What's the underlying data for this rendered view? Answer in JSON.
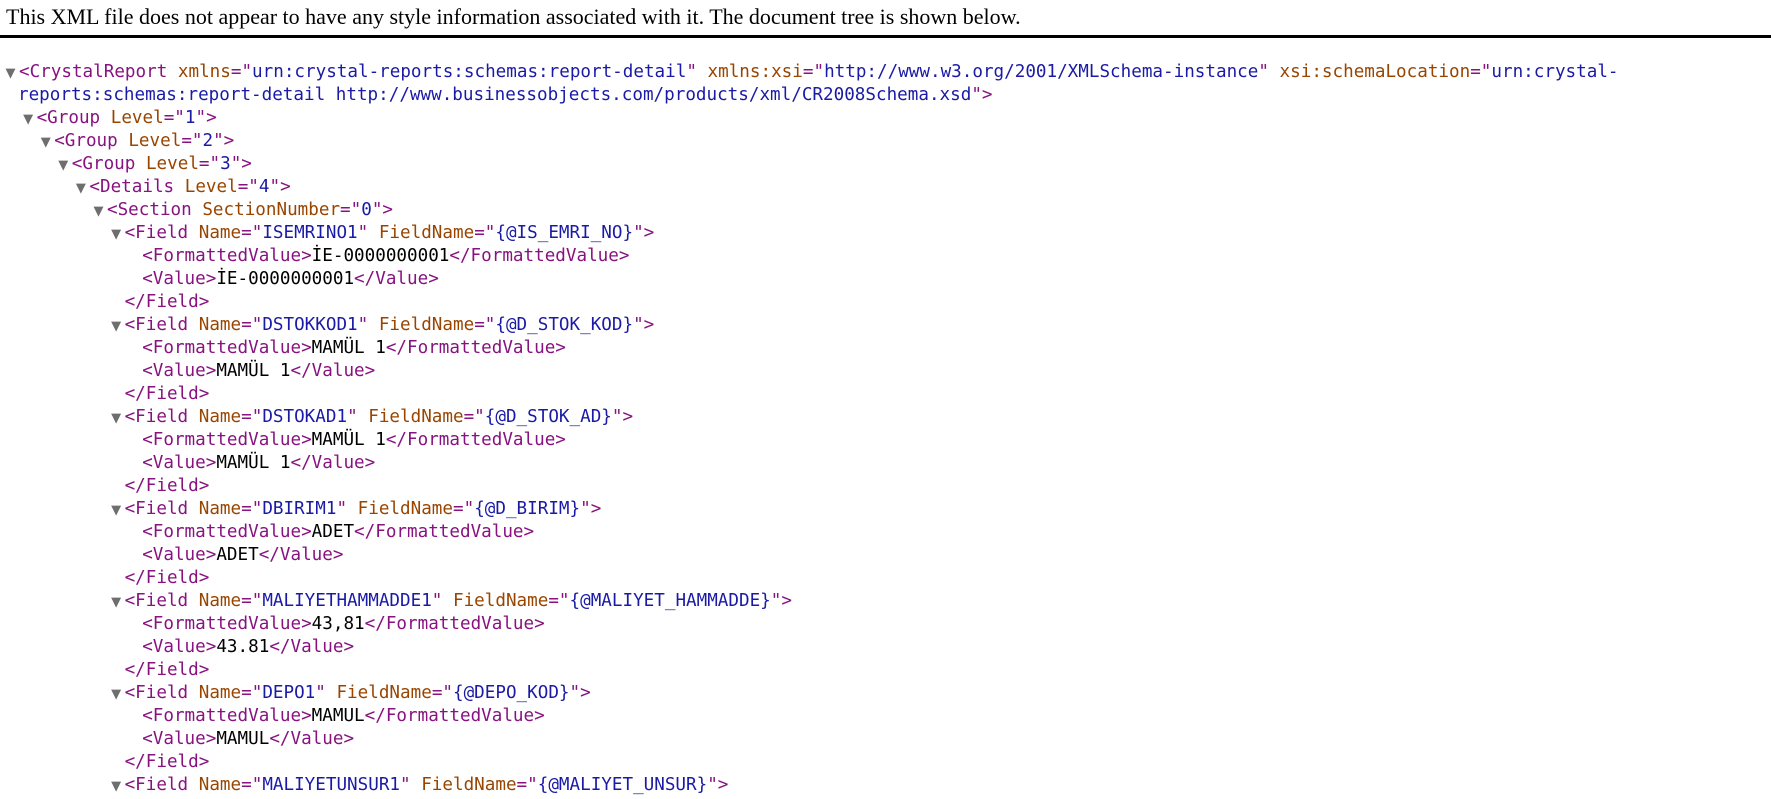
{
  "notice": "This XML file does not appear to have any style information associated with it. The document tree is shown below.",
  "toggle_glyph": "▼",
  "lines": [
    {
      "indent": 0,
      "toggle": true,
      "segments": [
        [
          "tg",
          "<CrystalReport"
        ],
        [
          "an",
          " xmlns"
        ],
        [
          "tg",
          "=\""
        ],
        [
          "av",
          "urn:crystal-reports:schemas:report-detail"
        ],
        [
          "tg",
          "\""
        ],
        [
          "an",
          " xmlns:xsi"
        ],
        [
          "tg",
          "=\""
        ],
        [
          "av",
          "http://www.w3.org/2001/XMLSchema-instance"
        ],
        [
          "tg",
          "\""
        ],
        [
          "an",
          " xsi:schemaLocation"
        ],
        [
          "tg",
          "=\""
        ],
        [
          "av",
          "urn:crystal-"
        ]
      ]
    },
    {
      "indent": 0,
      "toggle": false,
      "pad": 1,
      "segments": [
        [
          "av",
          "reports:schemas:report-detail http://www.businessobjects.com/products/xml/CR2008Schema.xsd"
        ],
        [
          "tg",
          "\">"
        ]
      ]
    },
    {
      "indent": 1,
      "toggle": true,
      "segments": [
        [
          "tg",
          "<Group"
        ],
        [
          "an",
          " Level"
        ],
        [
          "tg",
          "=\""
        ],
        [
          "av",
          "1"
        ],
        [
          "tg",
          "\">"
        ]
      ]
    },
    {
      "indent": 2,
      "toggle": true,
      "segments": [
        [
          "tg",
          "<Group"
        ],
        [
          "an",
          " Level"
        ],
        [
          "tg",
          "=\""
        ],
        [
          "av",
          "2"
        ],
        [
          "tg",
          "\">"
        ]
      ]
    },
    {
      "indent": 3,
      "toggle": true,
      "segments": [
        [
          "tg",
          "<Group"
        ],
        [
          "an",
          " Level"
        ],
        [
          "tg",
          "=\""
        ],
        [
          "av",
          "3"
        ],
        [
          "tg",
          "\">"
        ]
      ]
    },
    {
      "indent": 4,
      "toggle": true,
      "segments": [
        [
          "tg",
          "<Details"
        ],
        [
          "an",
          " Level"
        ],
        [
          "tg",
          "=\""
        ],
        [
          "av",
          "4"
        ],
        [
          "tg",
          "\">"
        ]
      ]
    },
    {
      "indent": 5,
      "toggle": true,
      "segments": [
        [
          "tg",
          "<Section"
        ],
        [
          "an",
          " SectionNumber"
        ],
        [
          "tg",
          "=\""
        ],
        [
          "av",
          "0"
        ],
        [
          "tg",
          "\">"
        ]
      ]
    },
    {
      "indent": 6,
      "toggle": true,
      "segments": [
        [
          "tg",
          "<Field"
        ],
        [
          "an",
          " Name"
        ],
        [
          "tg",
          "=\""
        ],
        [
          "av",
          "ISEMRINO1"
        ],
        [
          "tg",
          "\""
        ],
        [
          "an",
          " FieldName"
        ],
        [
          "tg",
          "=\""
        ],
        [
          "av",
          "{@IS_EMRI_NO}"
        ],
        [
          "tg",
          "\">"
        ]
      ]
    },
    {
      "indent": 7,
      "toggle": false,
      "segments": [
        [
          "tg",
          "<FormattedValue>"
        ],
        [
          "tx",
          "İE-0000000001"
        ],
        [
          "tg",
          "</FormattedValue>"
        ]
      ]
    },
    {
      "indent": 7,
      "toggle": false,
      "segments": [
        [
          "tg",
          "<Value>"
        ],
        [
          "tx",
          "İE-0000000001"
        ],
        [
          "tg",
          "</Value>"
        ]
      ]
    },
    {
      "indent": 6,
      "toggle": false,
      "segments": [
        [
          "tg",
          "</Field>"
        ]
      ]
    },
    {
      "indent": 6,
      "toggle": true,
      "segments": [
        [
          "tg",
          "<Field"
        ],
        [
          "an",
          " Name"
        ],
        [
          "tg",
          "=\""
        ],
        [
          "av",
          "DSTOKKOD1"
        ],
        [
          "tg",
          "\""
        ],
        [
          "an",
          " FieldName"
        ],
        [
          "tg",
          "=\""
        ],
        [
          "av",
          "{@D_STOK_KOD}"
        ],
        [
          "tg",
          "\">"
        ]
      ]
    },
    {
      "indent": 7,
      "toggle": false,
      "segments": [
        [
          "tg",
          "<FormattedValue>"
        ],
        [
          "tx",
          "MAMÜL 1"
        ],
        [
          "tg",
          "</FormattedValue>"
        ]
      ]
    },
    {
      "indent": 7,
      "toggle": false,
      "segments": [
        [
          "tg",
          "<Value>"
        ],
        [
          "tx",
          "MAMÜL 1"
        ],
        [
          "tg",
          "</Value>"
        ]
      ]
    },
    {
      "indent": 6,
      "toggle": false,
      "segments": [
        [
          "tg",
          "</Field>"
        ]
      ]
    },
    {
      "indent": 6,
      "toggle": true,
      "segments": [
        [
          "tg",
          "<Field"
        ],
        [
          "an",
          " Name"
        ],
        [
          "tg",
          "=\""
        ],
        [
          "av",
          "DSTOKAD1"
        ],
        [
          "tg",
          "\""
        ],
        [
          "an",
          " FieldName"
        ],
        [
          "tg",
          "=\""
        ],
        [
          "av",
          "{@D_STOK_AD}"
        ],
        [
          "tg",
          "\">"
        ]
      ]
    },
    {
      "indent": 7,
      "toggle": false,
      "segments": [
        [
          "tg",
          "<FormattedValue>"
        ],
        [
          "tx",
          "MAMÜL 1"
        ],
        [
          "tg",
          "</FormattedValue>"
        ]
      ]
    },
    {
      "indent": 7,
      "toggle": false,
      "segments": [
        [
          "tg",
          "<Value>"
        ],
        [
          "tx",
          "MAMÜL 1"
        ],
        [
          "tg",
          "</Value>"
        ]
      ]
    },
    {
      "indent": 6,
      "toggle": false,
      "segments": [
        [
          "tg",
          "</Field>"
        ]
      ]
    },
    {
      "indent": 6,
      "toggle": true,
      "segments": [
        [
          "tg",
          "<Field"
        ],
        [
          "an",
          " Name"
        ],
        [
          "tg",
          "=\""
        ],
        [
          "av",
          "DBIRIM1"
        ],
        [
          "tg",
          "\""
        ],
        [
          "an",
          " FieldName"
        ],
        [
          "tg",
          "=\""
        ],
        [
          "av",
          "{@D_BIRIM}"
        ],
        [
          "tg",
          "\">"
        ]
      ]
    },
    {
      "indent": 7,
      "toggle": false,
      "segments": [
        [
          "tg",
          "<FormattedValue>"
        ],
        [
          "tx",
          "ADET"
        ],
        [
          "tg",
          "</FormattedValue>"
        ]
      ]
    },
    {
      "indent": 7,
      "toggle": false,
      "segments": [
        [
          "tg",
          "<Value>"
        ],
        [
          "tx",
          "ADET"
        ],
        [
          "tg",
          "</Value>"
        ]
      ]
    },
    {
      "indent": 6,
      "toggle": false,
      "segments": [
        [
          "tg",
          "</Field>"
        ]
      ]
    },
    {
      "indent": 6,
      "toggle": true,
      "segments": [
        [
          "tg",
          "<Field"
        ],
        [
          "an",
          " Name"
        ],
        [
          "tg",
          "=\""
        ],
        [
          "av",
          "MALIYETHAMMADDE1"
        ],
        [
          "tg",
          "\""
        ],
        [
          "an",
          " FieldName"
        ],
        [
          "tg",
          "=\""
        ],
        [
          "av",
          "{@MALIYET_HAMMADDE}"
        ],
        [
          "tg",
          "\">"
        ]
      ]
    },
    {
      "indent": 7,
      "toggle": false,
      "segments": [
        [
          "tg",
          "<FormattedValue>"
        ],
        [
          "tx",
          "43,81"
        ],
        [
          "tg",
          "</FormattedValue>"
        ]
      ]
    },
    {
      "indent": 7,
      "toggle": false,
      "segments": [
        [
          "tg",
          "<Value>"
        ],
        [
          "tx",
          "43.81"
        ],
        [
          "tg",
          "</Value>"
        ]
      ]
    },
    {
      "indent": 6,
      "toggle": false,
      "segments": [
        [
          "tg",
          "</Field>"
        ]
      ]
    },
    {
      "indent": 6,
      "toggle": true,
      "segments": [
        [
          "tg",
          "<Field"
        ],
        [
          "an",
          " Name"
        ],
        [
          "tg",
          "=\""
        ],
        [
          "av",
          "DEPO1"
        ],
        [
          "tg",
          "\""
        ],
        [
          "an",
          " FieldName"
        ],
        [
          "tg",
          "=\""
        ],
        [
          "av",
          "{@DEPO_KOD}"
        ],
        [
          "tg",
          "\">"
        ]
      ]
    },
    {
      "indent": 7,
      "toggle": false,
      "segments": [
        [
          "tg",
          "<FormattedValue>"
        ],
        [
          "tx",
          "MAMUL"
        ],
        [
          "tg",
          "</FormattedValue>"
        ]
      ]
    },
    {
      "indent": 7,
      "toggle": false,
      "segments": [
        [
          "tg",
          "<Value>"
        ],
        [
          "tx",
          "MAMUL"
        ],
        [
          "tg",
          "</Value>"
        ]
      ]
    },
    {
      "indent": 6,
      "toggle": false,
      "segments": [
        [
          "tg",
          "</Field>"
        ]
      ]
    },
    {
      "indent": 6,
      "toggle": true,
      "segments": [
        [
          "tg",
          "<Field"
        ],
        [
          "an",
          " Name"
        ],
        [
          "tg",
          "=\""
        ],
        [
          "av",
          "MALIYETUNSUR1"
        ],
        [
          "tg",
          "\""
        ],
        [
          "an",
          " FieldName"
        ],
        [
          "tg",
          "=\""
        ],
        [
          "av",
          "{@MALIYET_UNSUR}"
        ],
        [
          "tg",
          "\">"
        ]
      ]
    }
  ]
}
